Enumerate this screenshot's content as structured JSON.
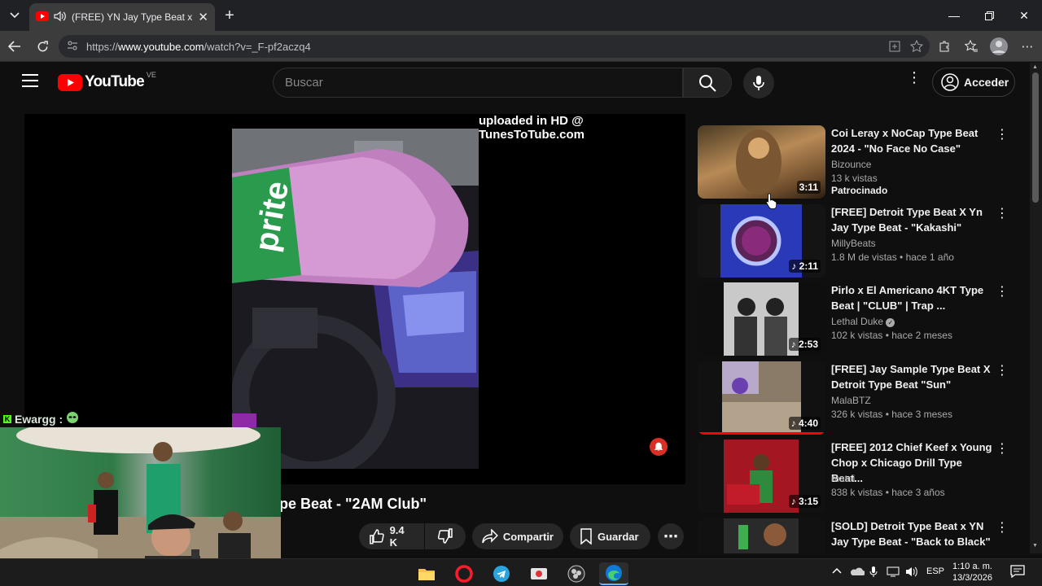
{
  "browser": {
    "tab_title": "(FREE) YN Jay Type Beat x Detroit",
    "new_tab_label": "+",
    "url_scheme": "https://",
    "url_host": "www.youtube.com",
    "url_path": "/watch?v=_F-pf2aczq4"
  },
  "youtube": {
    "logo_text": "YouTube",
    "region": "VE",
    "search_placeholder": "Buscar",
    "signin_label": "Acceder",
    "watermark": "uploaded in HD @ TunesToTube.com",
    "video_title_visible": "pe Beat - \"2AM Club\"",
    "actions": {
      "likes": "9.4 K",
      "share": "Compartir",
      "save": "Guardar"
    }
  },
  "recommendations": [
    {
      "title": "Coi Leray x NoCap Type Beat 2024 - \"No Face No Case\"",
      "channel": "Bizounce",
      "meta": "13 k vistas",
      "extra": "Patrocinado",
      "duration": "3:11"
    },
    {
      "title": "[FREE] Detroit Type Beat X Yn Jay Type Beat - \"Kakashi\"",
      "channel": "MillyBeats",
      "meta": "1.8 M de vistas • hace 1 año",
      "duration": "2:11"
    },
    {
      "title": "Pirlo x El Americano 4KT Type Beat | \"CLUB\" | Trap ...",
      "channel": "Lethal Duke",
      "meta": "102 k vistas • hace 2 meses",
      "duration": "2:53"
    },
    {
      "title": "[FREE] Jay Sample Type Beat X Detroit Type Beat \"Sun\"",
      "channel": "MalaBTZ",
      "meta": "326 k vistas • hace 3 meses",
      "duration": "4:40",
      "progress": 1.0
    },
    {
      "title": "[FREE] 2012 Chief Keef x Young Chop x Chicago Drill Type Beat...",
      "channel": "matai",
      "meta": "838 k vistas • hace 3 años",
      "duration": "3:15"
    },
    {
      "title": "[SOLD] Detroit Type Beat x YN Jay Type Beat - \"Back to Black\"",
      "channel": "",
      "meta": "",
      "duration": ""
    }
  ],
  "overlay": {
    "chat_user": "Ewargg :",
    "bottle_text": "Sprite"
  },
  "taskbar": {
    "lang": "ESP",
    "time": "1:10 a. m.",
    "date": "13/3/2026"
  }
}
